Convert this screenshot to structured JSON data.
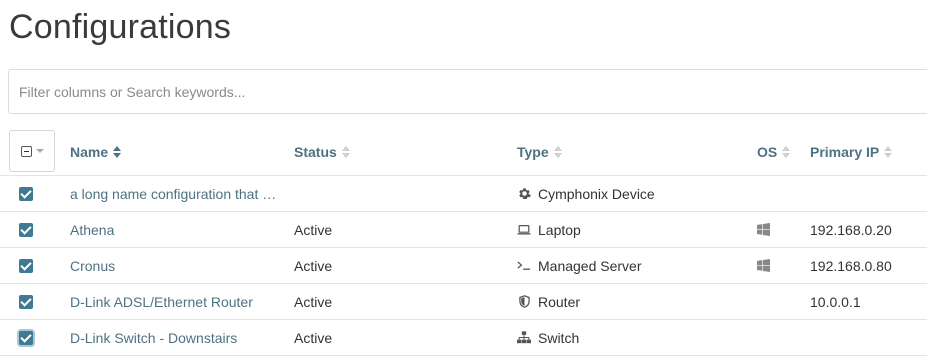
{
  "page": {
    "title": "Configurations"
  },
  "search": {
    "placeholder": "Filter columns or Search keywords..."
  },
  "table": {
    "columns": [
      {
        "key": "name",
        "label": "Name",
        "sort": "active"
      },
      {
        "key": "status",
        "label": "Status",
        "sort": "none"
      },
      {
        "key": "type",
        "label": "Type",
        "sort": "none"
      },
      {
        "key": "os",
        "label": "OS",
        "sort": "none"
      },
      {
        "key": "ip",
        "label": "Primary IP",
        "sort": "none"
      }
    ],
    "rows": [
      {
        "checked": true,
        "name": "a long name configuration that …",
        "status": "",
        "type_icon": "gear-icon",
        "type": "Cymphonix Device",
        "os_icon": "",
        "ip": ""
      },
      {
        "checked": true,
        "name": "Athena",
        "status": "Active",
        "type_icon": "laptop-icon",
        "type": "Laptop",
        "os_icon": "windows-icon",
        "ip": "192.168.0.20"
      },
      {
        "checked": true,
        "name": "Cronus",
        "status": "Active",
        "type_icon": "terminal-icon",
        "type": "Managed Server",
        "os_icon": "windows-icon",
        "ip": "192.168.0.80"
      },
      {
        "checked": true,
        "name": "D-Link ADSL/Ethernet Router",
        "status": "Active",
        "type_icon": "shield-icon",
        "type": "Router",
        "os_icon": "",
        "ip": "10.0.0.1"
      },
      {
        "checked": true,
        "name": "D-Link Switch - Downstairs",
        "status": "Active",
        "type_icon": "sitemap-icon",
        "type": "Switch",
        "os_icon": "",
        "ip": ""
      }
    ]
  },
  "colors": {
    "accent": "#4e7283",
    "checkbox": "#3f7a93",
    "border": "#e4e4e4"
  }
}
